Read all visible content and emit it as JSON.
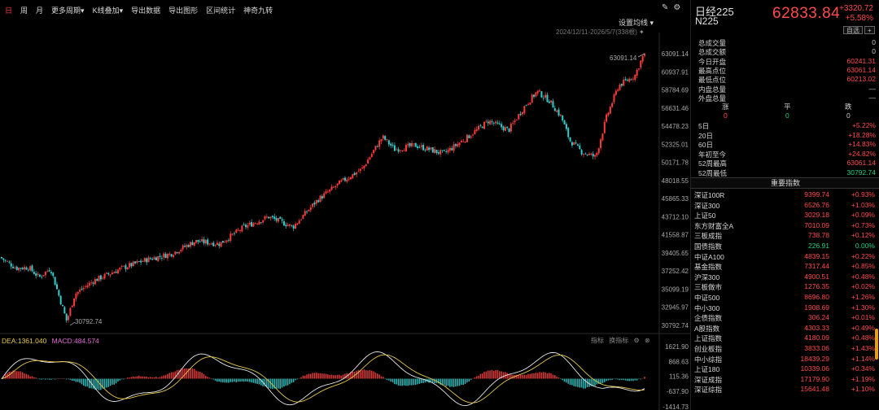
{
  "toolbar": {
    "items": [
      "日",
      "周",
      "月",
      "更多周期▾",
      "K线叠加▾",
      "导出数据",
      "导出图形",
      "区间统计",
      "神奇九转"
    ],
    "active_index": 0
  },
  "main_chart": {
    "ma_settings": "设置均线 ▾",
    "date_range": "2024/12/11-2026/5/7(338根)",
    "y_ticks": [
      "63091.14",
      "60937.91",
      "58784.69",
      "56631.46",
      "54478.23",
      "52325.01",
      "50171.78",
      "48018.55",
      "45865.33",
      "43712.10",
      "41558.87",
      "39405.65",
      "37252.42",
      "35099.19",
      "32945.97",
      "30792.74"
    ],
    "high_marker": "63091.14",
    "low_marker": "30792.74",
    "colors": {
      "up": "#ff3b3b",
      "down": "#2fd0d0",
      "grid": "#222222"
    }
  },
  "macd": {
    "dea_label": "DEA:1361.040",
    "macd_label": "MACD:484.574",
    "tools": [
      "指标",
      "换指标"
    ],
    "y_ticks": [
      "1621.90",
      "868.63",
      "115.36",
      "-637.90",
      "-1414.73"
    ],
    "colors": {
      "dif": "#e6e6e6",
      "dea": "#e6c84a"
    }
  },
  "panel": {
    "name": "日经225",
    "code": "N225",
    "price": "62833.84",
    "change": "+3320.72",
    "change_pct": "+5.58%",
    "buttons": [
      "自选",
      "+"
    ],
    "stats": [
      {
        "label": "总成交量",
        "value": "0",
        "color": "normal"
      },
      {
        "label": "总成交额",
        "value": "0",
        "color": "normal"
      },
      {
        "label": "今日开盘",
        "value": "60241.31",
        "color": "red"
      },
      {
        "label": "最高点位",
        "value": "63061.14",
        "color": "red"
      },
      {
        "label": "最低点位",
        "value": "60213.02",
        "color": "red"
      },
      {
        "label": "内盘总量",
        "value": "—",
        "color": "normal"
      },
      {
        "label": "外盘总量",
        "value": "—",
        "color": "normal"
      }
    ],
    "zpd": {
      "labels": [
        "涨",
        "平",
        "跌"
      ],
      "values": [
        "0",
        "0",
        "0"
      ]
    },
    "periods": [
      {
        "label": "5日",
        "value": "+5.22%",
        "color": "red"
      },
      {
        "label": "20日",
        "value": "+18.28%",
        "color": "red"
      },
      {
        "label": "60日",
        "value": "+14.83%",
        "color": "red"
      },
      {
        "label": "年初至今",
        "value": "+24.82%",
        "color": "red"
      },
      {
        "label": "52周最高",
        "value": "63061.14",
        "color": "red"
      },
      {
        "label": "52周最低",
        "value": "30792.74",
        "color": "green"
      }
    ],
    "index_title": "重要指数",
    "indices": [
      {
        "name": "深证100R",
        "price": "9399.74",
        "chg": "+0.93%"
      },
      {
        "name": "深证300",
        "price": "6526.76",
        "chg": "+1.03%"
      },
      {
        "name": "上证50",
        "price": "3029.18",
        "chg": "+0.09%"
      },
      {
        "name": "东方财富全A",
        "price": "7010.09",
        "chg": "+0.73%"
      },
      {
        "name": "三板成指",
        "price": "738.78",
        "chg": "+0.12%"
      },
      {
        "name": "国债指数",
        "price": "226.91",
        "chg": "0.00%"
      },
      {
        "name": "中证A100",
        "price": "4839.15",
        "chg": "+0.22%"
      },
      {
        "name": "基金指数",
        "price": "7317.44",
        "chg": "+0.85%"
      },
      {
        "name": "沪深300",
        "price": "4900.51",
        "chg": "+0.48%"
      },
      {
        "name": "三板做市",
        "price": "1276.35",
        "chg": "+0.02%"
      },
      {
        "name": "中证500",
        "price": "8696.80",
        "chg": "+1.26%"
      },
      {
        "name": "中小300",
        "price": "1908.69",
        "chg": "+1.30%"
      },
      {
        "name": "企债指数",
        "price": "306.24",
        "chg": "+0.01%"
      },
      {
        "name": "A股指数",
        "price": "4303.33",
        "chg": "+0.49%"
      },
      {
        "name": "上证指数",
        "price": "4180.09",
        "chg": "+0.48%"
      },
      {
        "name": "创业板指",
        "price": "3833.06",
        "chg": "+1.43%"
      },
      {
        "name": "中小综指",
        "price": "18439.29",
        "chg": "+1.14%"
      },
      {
        "name": "上证180",
        "price": "10339.06",
        "chg": "+0.34%"
      },
      {
        "name": "深证成指",
        "price": "17179.90",
        "chg": "+1.19%"
      },
      {
        "name": "深证综指",
        "price": "15641.48",
        "chg": "+1.10%"
      }
    ]
  }
}
